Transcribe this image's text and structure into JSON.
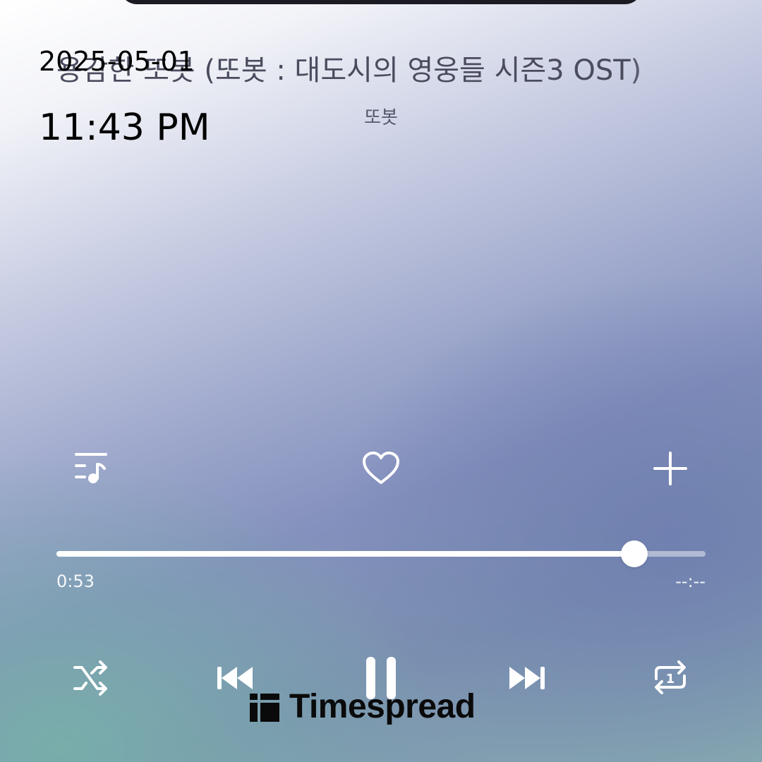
{
  "track": {
    "title": "용감한 또봇 (또봇 : 대도시의 영웅들 시즌3 OST)",
    "artist": "또봇"
  },
  "stamp": {
    "date": "2025-05-01",
    "time": "11:43 PM"
  },
  "actions": {
    "playlist_icon": "playlist-music-icon",
    "like_icon": "heart-outline-icon",
    "add_icon": "plus-icon"
  },
  "progress": {
    "elapsed": "0:53",
    "total": "--:--",
    "fraction": 0.89
  },
  "controls": {
    "shuffle_icon": "shuffle-icon",
    "previous_icon": "skip-previous-icon",
    "pause_icon": "pause-icon",
    "next_icon": "skip-next-icon",
    "repeat_icon": "repeat-one-icon",
    "repeat_badge": "1"
  },
  "watermark": {
    "brand": "Timespread"
  },
  "colors": {
    "icon": "#ffffff",
    "stamp_text": "#000000",
    "title_text": "#4a4c5e"
  }
}
